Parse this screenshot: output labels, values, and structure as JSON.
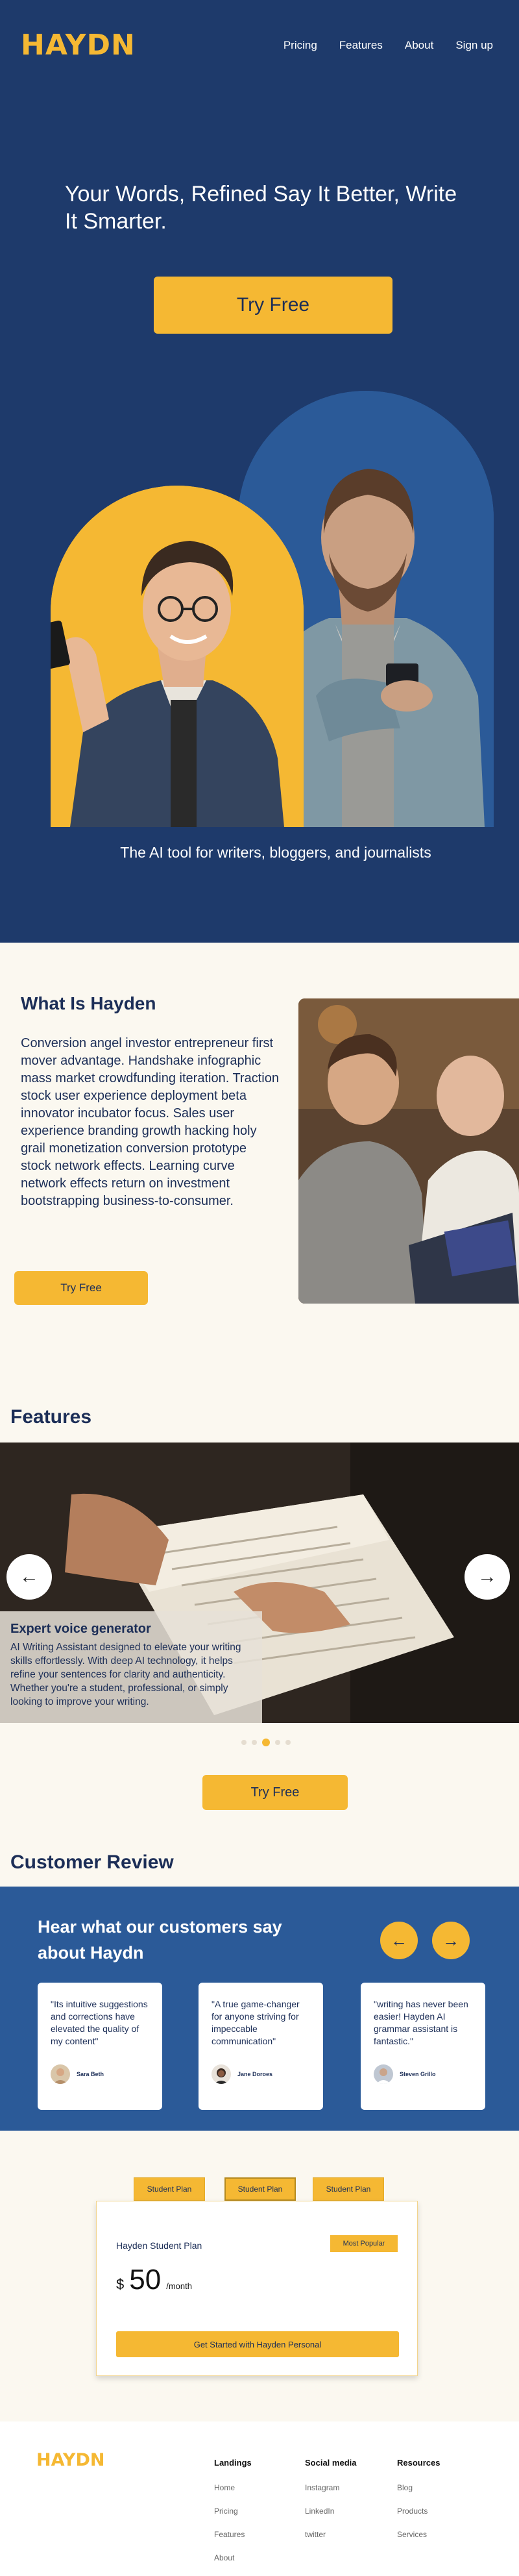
{
  "brand": {
    "logo": "HAYDN",
    "accent": "#f5b833",
    "navy": "#1e3a6b",
    "blue": "#2b5a98"
  },
  "nav": [
    "Pricing",
    "Features",
    "About",
    "Sign up"
  ],
  "hero": {
    "title": "Your Words, Refined  Say It Better, Write It Smarter.",
    "cta": "Try  Free",
    "tagline": "The AI tool for writers, bloggers, and journalists"
  },
  "about": {
    "title": "What Is Hayden",
    "body": "Conversion angel investor entrepreneur first mover advantage. Handshake infographic mass market crowdfunding iteration. Traction stock user experience deployment beta innovator incubator focus. Sales user experience branding growth hacking holy grail monetization conversion prototype stock network effects. Learning curve network effects return on investment bootstrapping business-to-consumer.",
    "cta": "Try  Free"
  },
  "features": {
    "title": "Features",
    "slide_title": "Expert voice generator",
    "slide_text": "AI Writing Assistant designed to elevate your writing skills effortlessly. With deep AI technology, it helps refine your sentences for clarity and authenticity. Whether you're a student, professional, or simply looking to improve your writing.",
    "prev_icon": "arrow-left-icon",
    "next_icon": "arrow-right-icon",
    "slide_count": 5,
    "active_slide": 3,
    "cta": "Try  Free"
  },
  "reviews": {
    "section_title": "Customer Review",
    "heading": "Hear what our customers say about Haydn",
    "items": [
      {
        "quote": "\"Its intuitive suggestions and corrections have elevated the quality of my content\"",
        "name": "Sara Beth"
      },
      {
        "quote": "\"A true game-changer for anyone striving for impeccable communication\"",
        "name": "Jane Doroes"
      },
      {
        "quote": "\"writing has never been easier! Hayden AI grammar assistant  is fantastic.\"",
        "name": "Steven Grillo"
      }
    ]
  },
  "pricing": {
    "tabs": [
      "Student Plan",
      "Student Plan",
      "Student Plan"
    ],
    "plan_name": "Hayden Student Plan",
    "badge": "Most Popular",
    "currency": "$",
    "amount": "50",
    "period": "/month",
    "cta": "Get Started with Hayden Personal"
  },
  "footer": {
    "logo": "HAYDN",
    "columns": [
      {
        "title": "Landings",
        "links": [
          "Home",
          "Pricing",
          "Features",
          "About"
        ]
      },
      {
        "title": "Social media",
        "links": [
          "Instagram",
          "LinkedIn",
          "twitter"
        ]
      },
      {
        "title": "Resources",
        "links": [
          "Blog",
          "Products",
          "Services"
        ]
      }
    ]
  }
}
